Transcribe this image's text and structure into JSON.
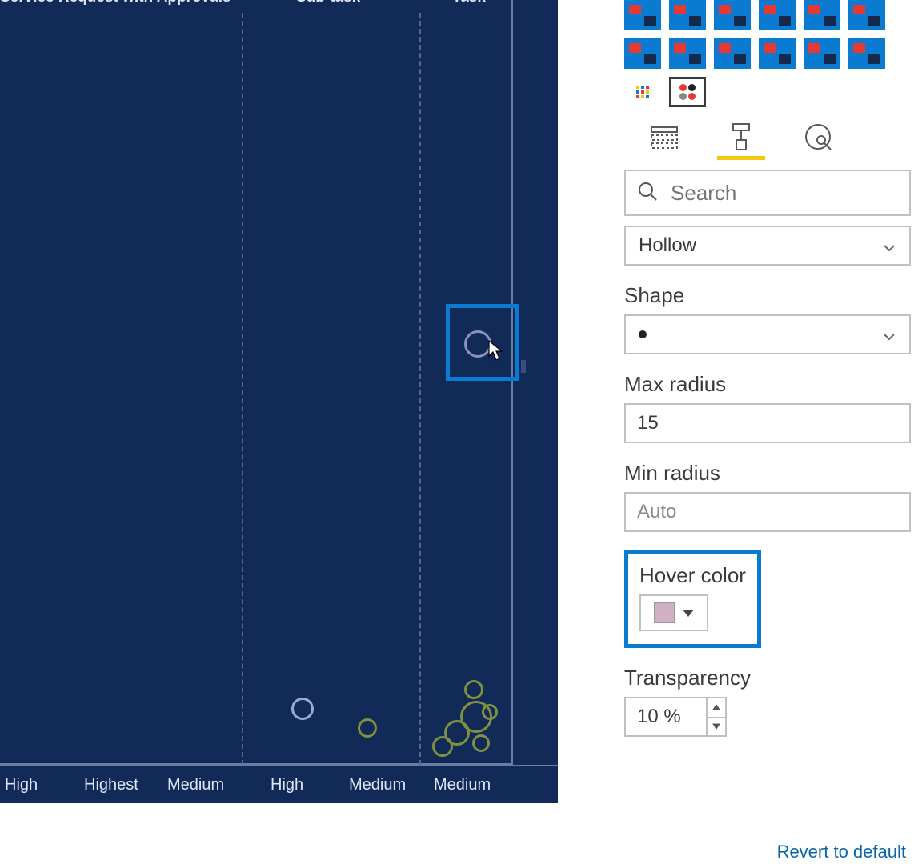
{
  "chart": {
    "headers": [
      "Service Request with Approvals",
      "Sub-task",
      "Task"
    ],
    "axis_labels": [
      "High",
      "Highest",
      "Medium",
      "High",
      "Medium",
      "Medium"
    ]
  },
  "panel": {
    "search_placeholder": "Search",
    "marker_style_label": "",
    "marker_style_value": "Hollow",
    "shape_label": "Shape",
    "max_radius_label": "Max radius",
    "max_radius_value": "15",
    "min_radius_label": "Min radius",
    "min_radius_placeholder": "Auto",
    "hover_color_label": "Hover color",
    "hover_color_hex": "#d0b0c4",
    "transparency_label": "Transparency",
    "transparency_value": "10",
    "transparency_unit": "%",
    "revert_label": "Revert to default"
  }
}
